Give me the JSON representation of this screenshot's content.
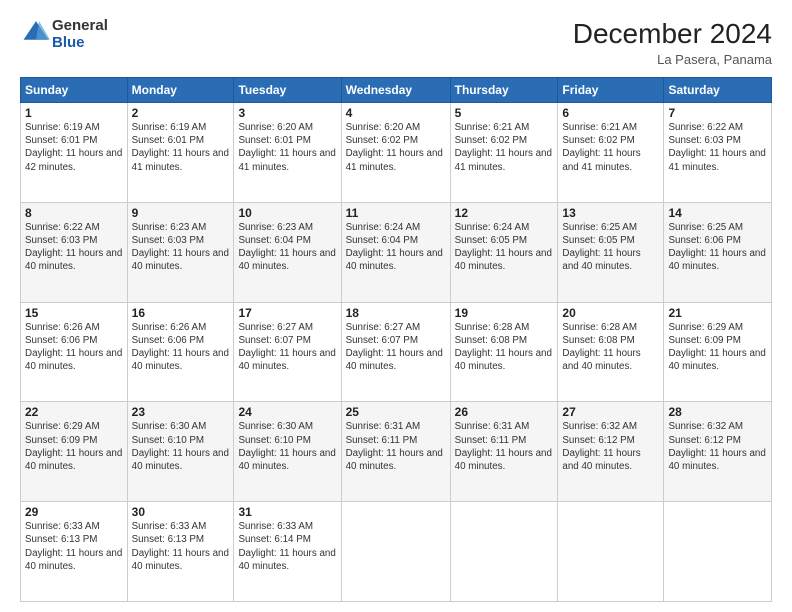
{
  "logo": {
    "general": "General",
    "blue": "Blue"
  },
  "header": {
    "month": "December 2024",
    "location": "La Pasera, Panama"
  },
  "days_of_week": [
    "Sunday",
    "Monday",
    "Tuesday",
    "Wednesday",
    "Thursday",
    "Friday",
    "Saturday"
  ],
  "weeks": [
    [
      {
        "day": "1",
        "sunrise": "6:19 AM",
        "sunset": "6:01 PM",
        "daylight": "11 hours and 42 minutes"
      },
      {
        "day": "2",
        "sunrise": "6:19 AM",
        "sunset": "6:01 PM",
        "daylight": "11 hours and 41 minutes"
      },
      {
        "day": "3",
        "sunrise": "6:20 AM",
        "sunset": "6:01 PM",
        "daylight": "11 hours and 41 minutes"
      },
      {
        "day": "4",
        "sunrise": "6:20 AM",
        "sunset": "6:02 PM",
        "daylight": "11 hours and 41 minutes"
      },
      {
        "day": "5",
        "sunrise": "6:21 AM",
        "sunset": "6:02 PM",
        "daylight": "11 hours and 41 minutes"
      },
      {
        "day": "6",
        "sunrise": "6:21 AM",
        "sunset": "6:02 PM",
        "daylight": "11 hours and 41 minutes"
      },
      {
        "day": "7",
        "sunrise": "6:22 AM",
        "sunset": "6:03 PM",
        "daylight": "11 hours and 41 minutes"
      }
    ],
    [
      {
        "day": "8",
        "sunrise": "6:22 AM",
        "sunset": "6:03 PM",
        "daylight": "11 hours and 40 minutes"
      },
      {
        "day": "9",
        "sunrise": "6:23 AM",
        "sunset": "6:03 PM",
        "daylight": "11 hours and 40 minutes"
      },
      {
        "day": "10",
        "sunrise": "6:23 AM",
        "sunset": "6:04 PM",
        "daylight": "11 hours and 40 minutes"
      },
      {
        "day": "11",
        "sunrise": "6:24 AM",
        "sunset": "6:04 PM",
        "daylight": "11 hours and 40 minutes"
      },
      {
        "day": "12",
        "sunrise": "6:24 AM",
        "sunset": "6:05 PM",
        "daylight": "11 hours and 40 minutes"
      },
      {
        "day": "13",
        "sunrise": "6:25 AM",
        "sunset": "6:05 PM",
        "daylight": "11 hours and 40 minutes"
      },
      {
        "day": "14",
        "sunrise": "6:25 AM",
        "sunset": "6:06 PM",
        "daylight": "11 hours and 40 minutes"
      }
    ],
    [
      {
        "day": "15",
        "sunrise": "6:26 AM",
        "sunset": "6:06 PM",
        "daylight": "11 hours and 40 minutes"
      },
      {
        "day": "16",
        "sunrise": "6:26 AM",
        "sunset": "6:06 PM",
        "daylight": "11 hours and 40 minutes"
      },
      {
        "day": "17",
        "sunrise": "6:27 AM",
        "sunset": "6:07 PM",
        "daylight": "11 hours and 40 minutes"
      },
      {
        "day": "18",
        "sunrise": "6:27 AM",
        "sunset": "6:07 PM",
        "daylight": "11 hours and 40 minutes"
      },
      {
        "day": "19",
        "sunrise": "6:28 AM",
        "sunset": "6:08 PM",
        "daylight": "11 hours and 40 minutes"
      },
      {
        "day": "20",
        "sunrise": "6:28 AM",
        "sunset": "6:08 PM",
        "daylight": "11 hours and 40 minutes"
      },
      {
        "day": "21",
        "sunrise": "6:29 AM",
        "sunset": "6:09 PM",
        "daylight": "11 hours and 40 minutes"
      }
    ],
    [
      {
        "day": "22",
        "sunrise": "6:29 AM",
        "sunset": "6:09 PM",
        "daylight": "11 hours and 40 minutes"
      },
      {
        "day": "23",
        "sunrise": "6:30 AM",
        "sunset": "6:10 PM",
        "daylight": "11 hours and 40 minutes"
      },
      {
        "day": "24",
        "sunrise": "6:30 AM",
        "sunset": "6:10 PM",
        "daylight": "11 hours and 40 minutes"
      },
      {
        "day": "25",
        "sunrise": "6:31 AM",
        "sunset": "6:11 PM",
        "daylight": "11 hours and 40 minutes"
      },
      {
        "day": "26",
        "sunrise": "6:31 AM",
        "sunset": "6:11 PM",
        "daylight": "11 hours and 40 minutes"
      },
      {
        "day": "27",
        "sunrise": "6:32 AM",
        "sunset": "6:12 PM",
        "daylight": "11 hours and 40 minutes"
      },
      {
        "day": "28",
        "sunrise": "6:32 AM",
        "sunset": "6:12 PM",
        "daylight": "11 hours and 40 minutes"
      }
    ],
    [
      {
        "day": "29",
        "sunrise": "6:33 AM",
        "sunset": "6:13 PM",
        "daylight": "11 hours and 40 minutes"
      },
      {
        "day": "30",
        "sunrise": "6:33 AM",
        "sunset": "6:13 PM",
        "daylight": "11 hours and 40 minutes"
      },
      {
        "day": "31",
        "sunrise": "6:33 AM",
        "sunset": "6:14 PM",
        "daylight": "11 hours and 40 minutes"
      },
      null,
      null,
      null,
      null
    ]
  ],
  "labels": {
    "sunrise": "Sunrise:",
    "sunset": "Sunset:",
    "daylight": "Daylight:"
  }
}
